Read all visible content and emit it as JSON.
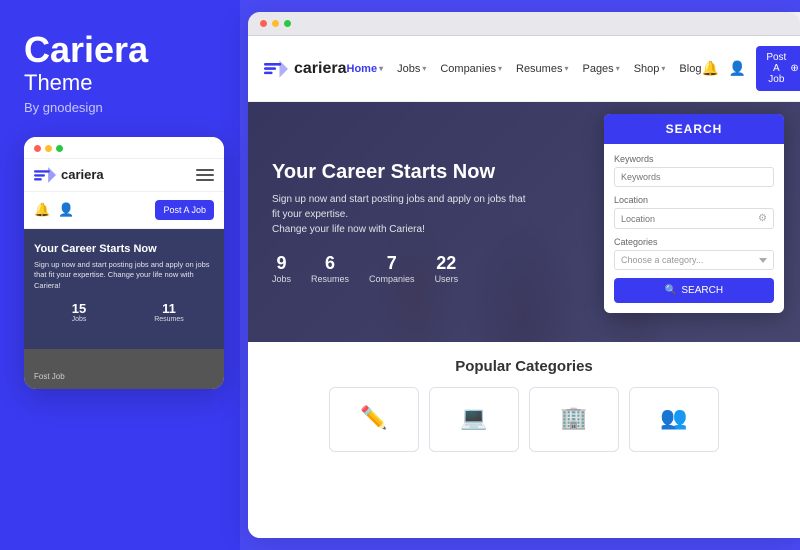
{
  "left": {
    "brand": {
      "title": "Cariera",
      "subtitle": "Theme",
      "by": "By gnodesign"
    },
    "mobile_preview": {
      "logo_text": "cariera",
      "post_job_label": "Post A Job",
      "hero_title": "Your Career Starts Now",
      "hero_desc": "Sign up now and start posting jobs and apply on jobs that fit your expertise. Change your life now with Cariera!",
      "stats": [
        {
          "num": "15",
          "label": "Jobs"
        },
        {
          "num": "11",
          "label": "Resumes"
        }
      ],
      "fost_job": "Fost  Job"
    }
  },
  "right": {
    "browser_dots": [
      "red",
      "yellow",
      "green"
    ],
    "nav": {
      "logo": "cariera",
      "links": [
        {
          "label": "Home",
          "has_dropdown": true,
          "active": true
        },
        {
          "label": "Jobs",
          "has_dropdown": true
        },
        {
          "label": "Companies",
          "has_dropdown": true
        },
        {
          "label": "Resumes",
          "has_dropdown": true
        },
        {
          "label": "Pages",
          "has_dropdown": true
        },
        {
          "label": "Shop",
          "has_dropdown": true
        },
        {
          "label": "Blog"
        }
      ],
      "post_job_label": "Post A Job"
    },
    "hero": {
      "title": "Your Career Starts Now",
      "desc_line1": "Sign up now and start posting jobs and apply on jobs that fit your expertise.",
      "desc_line2": "Change your life now with Cariera!",
      "stats": [
        {
          "num": "9",
          "label": "Jobs"
        },
        {
          "num": "6",
          "label": "Resumes"
        },
        {
          "num": "7",
          "label": "Companies"
        },
        {
          "num": "22",
          "label": "Users"
        }
      ]
    },
    "search": {
      "header": "SEARCH",
      "keywords_label": "Keywords",
      "keywords_placeholder": "Keywords",
      "location_label": "Location",
      "location_placeholder": "Location",
      "categories_label": "Categories",
      "categories_placeholder": "Choose a category...",
      "search_button": "SEARCH"
    },
    "popular": {
      "title": "Popular Categories",
      "categories": [
        {
          "icon": "✏️",
          "label": ""
        },
        {
          "icon": "💻",
          "label": ""
        },
        {
          "icon": "🏢",
          "label": ""
        },
        {
          "icon": "👥",
          "label": ""
        }
      ]
    }
  }
}
